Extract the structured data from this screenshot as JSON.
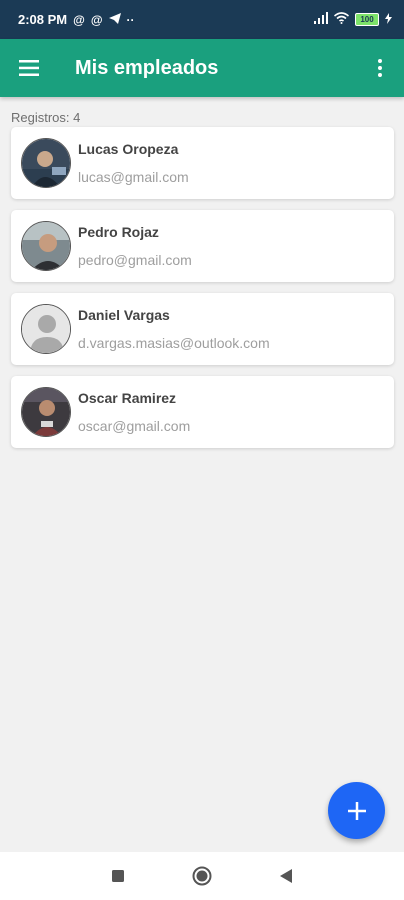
{
  "status_bar": {
    "time": "2:08 PM",
    "left_icons": [
      "at-sign-icon",
      "at-sign-icon",
      "telegram-icon",
      "more-dots-icon"
    ],
    "right_icons": [
      "signal-icon",
      "wifi-icon",
      "battery-icon"
    ],
    "battery_level": "100"
  },
  "app_bar": {
    "title": "Mis empleados",
    "menu_icon": "hamburger-menu-icon",
    "overflow_icon": "more-vert-icon",
    "background": "#1aa07e"
  },
  "records_label": "Registros: 4",
  "employees": [
    {
      "name": "Lucas Oropeza",
      "email": "lucas@gmail.com",
      "avatar": "photo"
    },
    {
      "name": "Pedro Rojaz",
      "email": "pedro@gmail.com",
      "avatar": "photo"
    },
    {
      "name": "Daniel Vargas",
      "email": "d.vargas.masias@outlook.com",
      "avatar": "default-person"
    },
    {
      "name": "Oscar Ramirez",
      "email": "oscar@gmail.com",
      "avatar": "photo"
    }
  ],
  "fab": {
    "icon": "plus-icon",
    "color": "#1e66f5"
  },
  "nav_bar": {
    "icons": [
      "recents-square-icon",
      "home-circle-icon",
      "back-triangle-icon"
    ]
  }
}
